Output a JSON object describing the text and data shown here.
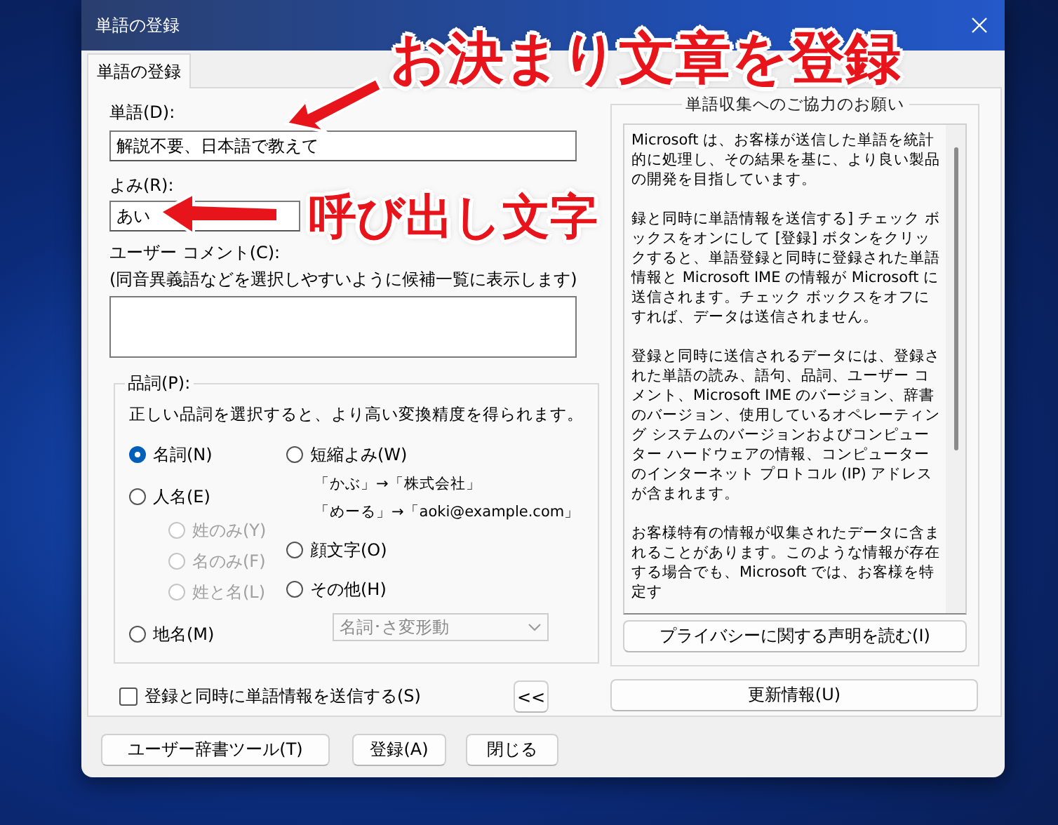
{
  "window": {
    "title": "単語の登録"
  },
  "tabs": [
    {
      "label": "単語の登録",
      "selected": true
    }
  ],
  "word_field": {
    "label": "単語(D):",
    "value": "解説不要、日本語で教えて"
  },
  "reading_field": {
    "label": "よみ(R):",
    "value": "あい"
  },
  "comment_field": {
    "label": "ユーザー コメント(C):",
    "hint": "(同音異義語などを選択しやすいように候補一覧に表示します)"
  },
  "part_of_speech": {
    "label": "品詞(P):",
    "description": "正しい品詞を選択すると、より高い変換精度を得られます。",
    "left_options": [
      {
        "label": "名詞(N)",
        "selected": true,
        "disabled": false
      },
      {
        "label": "人名(E)",
        "selected": false,
        "disabled": false,
        "children": [
          {
            "label": "姓のみ(Y)",
            "selected": false,
            "disabled": true
          },
          {
            "label": "名のみ(F)",
            "selected": false,
            "disabled": true
          },
          {
            "label": "姓と名(L)",
            "selected": false,
            "disabled": true
          }
        ]
      },
      {
        "label": "地名(M)",
        "selected": false,
        "disabled": false
      }
    ],
    "right_options": [
      {
        "label": "短縮よみ(W)",
        "selected": false,
        "disabled": false,
        "examples": [
          "「かぶ」→「株式会社」",
          "「めーる」→「aoki@example.com」"
        ]
      },
      {
        "label": "顔文字(O)",
        "selected": false,
        "disabled": false
      },
      {
        "label": "その他(H)",
        "selected": false,
        "disabled": false
      }
    ],
    "dropdown": {
      "value": "名詞･さ変形動",
      "disabled": true
    }
  },
  "send_checkbox": {
    "label": "登録と同時に単語情報を送信する(S)",
    "checked": false
  },
  "collapse_button": "<<",
  "info_panel": {
    "title": "単語収集へのご協力のお願い",
    "paragraphs": [
      "Microsoft は、お客様が送信した単語を統計的に処理し、その結果を基に、より良い製品の開発を目指しています。",
      "録と同時に単語情報を送信する] チェック ボックスをオンにして [登録] ボタンをクリックすると、単語登録と同時に登録された単語情報と Microsoft IME の情報が Microsoft に送信されます。チェック ボックスをオフにすれば、データは送信されません。",
      "登録と同時に送信されるデータには、登録された単語の読み、語句、品詞、ユーザー コメント、Microsoft IME のバージョン、辞書のバージョン、使用しているオペレーティング システムのバージョンおよびコンピューター ハードウェアの情報、コンピューターのインターネット プロトコル (IP) アドレスが含まれます。",
      "お客様特有の情報が収集されたデータに含まれることがあります。このような情報が存在する場合でも、Microsoft では、お客様を特定す"
    ],
    "privacy_button": "プライバシーに関する声明を読む(I)"
  },
  "update_button": "更新情報(U)",
  "buttons": [
    "ユーザー辞書ツール(T)",
    "登録(A)",
    "閉じる"
  ],
  "annotations": [
    {
      "text": "お決まり文章を登録"
    },
    {
      "text": "呼び出し文字"
    }
  ]
}
